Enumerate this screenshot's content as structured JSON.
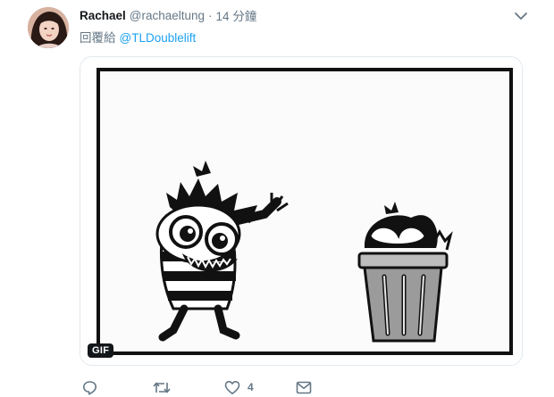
{
  "tweet": {
    "display_name": "Rachael",
    "handle": "@rachaeltung",
    "separator": "·",
    "time": "14 分鐘",
    "reply_prefix": "回覆給",
    "reply_mention": "@TLDoublelift"
  },
  "media": {
    "badge": "GIF"
  },
  "actions": {
    "reply_count": "",
    "retweet_count": "",
    "like_count": "4",
    "dm_count": ""
  },
  "colors": {
    "link": "#1da1f2",
    "secondary_text": "#657786",
    "primary_text": "#14171a",
    "border": "#e1e8ed"
  },
  "icons": [
    "caret-down-icon",
    "reply-icon",
    "retweet-icon",
    "heart-icon",
    "message-icon"
  ]
}
